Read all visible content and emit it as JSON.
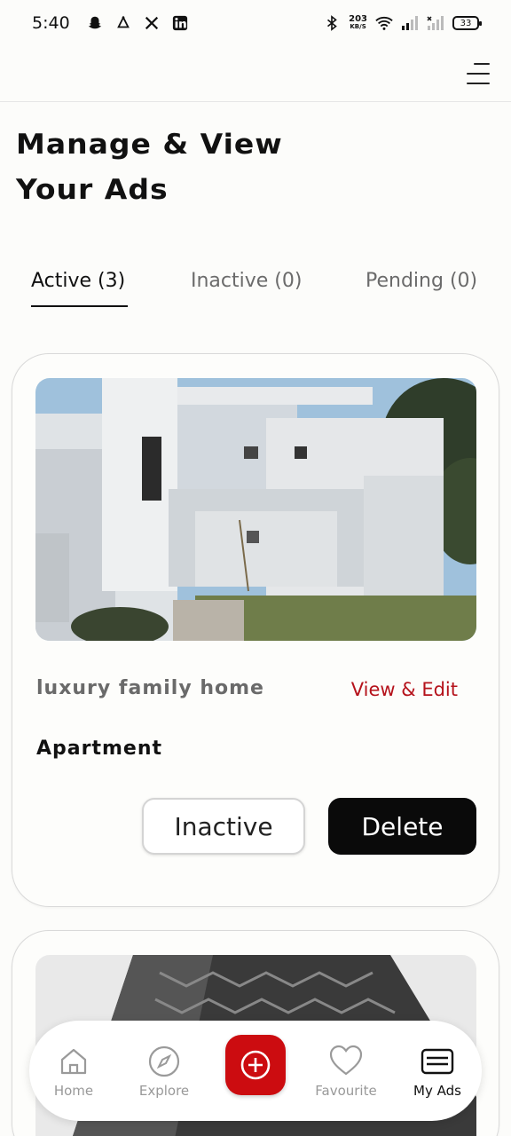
{
  "status_bar": {
    "time": "5:40",
    "net_speed_value": "203",
    "net_speed_unit": "KB/S",
    "battery": "33",
    "icons": [
      "snapchat-icon",
      "bell-icon",
      "x-icon",
      "linkedin-icon",
      "bluetooth-icon",
      "wifi-icon",
      "signal-icon",
      "signal-icon"
    ]
  },
  "header": {
    "title": "Manage & View\nYour Ads",
    "menu_icon": "hamburger-menu-icon"
  },
  "tabs": [
    {
      "label": "Active (3)",
      "active": true
    },
    {
      "label": "Inactive (0)",
      "active": false
    },
    {
      "label": "Pending (0)",
      "active": false
    }
  ],
  "ads": [
    {
      "title": "luxury family home",
      "view_edit_label": "View & Edit",
      "type": "Apartment",
      "inactive_label": "Inactive",
      "delete_label": "Delete"
    }
  ],
  "bottom_nav": {
    "items": [
      {
        "label": "Home",
        "icon": "home-icon"
      },
      {
        "label": "Explore",
        "icon": "compass-icon"
      },
      {
        "label": "",
        "icon": "add-circle-icon"
      },
      {
        "label": "Favourite",
        "icon": "heart-icon"
      },
      {
        "label": "My Ads",
        "icon": "list-icon",
        "active": true
      }
    ]
  },
  "colors": {
    "accent": "#cc0c10",
    "link": "#b5121b",
    "dark_button": "#0a0a0a"
  }
}
